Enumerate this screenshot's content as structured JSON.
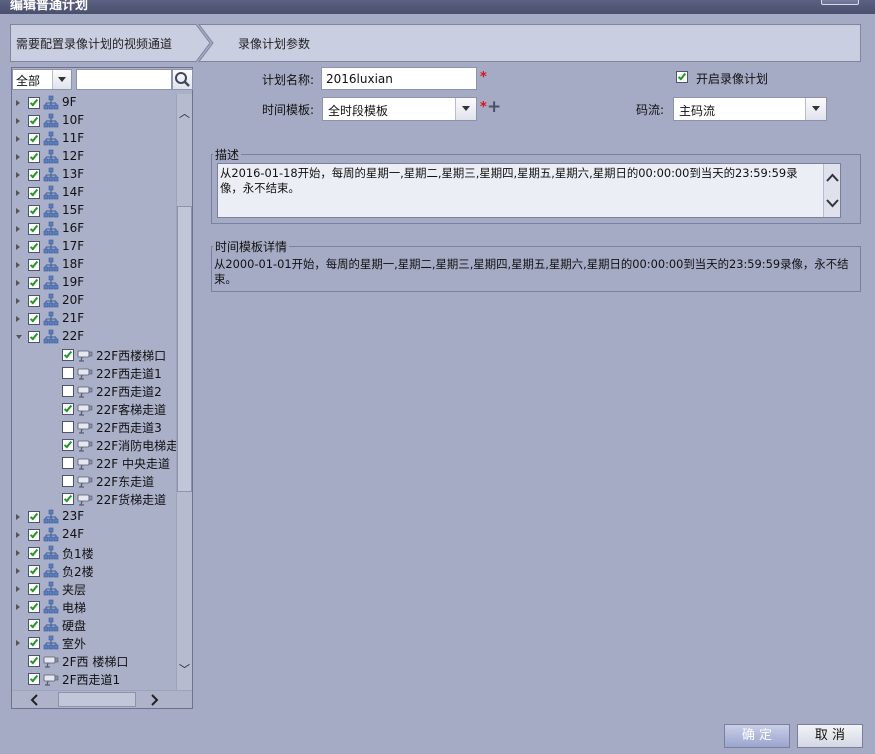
{
  "window": {
    "title": "编辑普通计划"
  },
  "steps": [
    {
      "label": "需要配置录像计划的视频通道"
    },
    {
      "label": "录像计划参数"
    }
  ],
  "filter": {
    "scope_value": "全部",
    "search_value": ""
  },
  "tree": [
    {
      "label": "9F",
      "type": "group",
      "level": 0,
      "checked": true,
      "expanded": false
    },
    {
      "label": "10F",
      "type": "group",
      "level": 0,
      "checked": true,
      "expanded": false
    },
    {
      "label": "11F",
      "type": "group",
      "level": 0,
      "checked": true,
      "expanded": false
    },
    {
      "label": "12F",
      "type": "group",
      "level": 0,
      "checked": true,
      "expanded": false
    },
    {
      "label": "13F",
      "type": "group",
      "level": 0,
      "checked": true,
      "expanded": false
    },
    {
      "label": "14F",
      "type": "group",
      "level": 0,
      "checked": true,
      "expanded": false
    },
    {
      "label": "15F",
      "type": "group",
      "level": 0,
      "checked": true,
      "expanded": false
    },
    {
      "label": "16F",
      "type": "group",
      "level": 0,
      "checked": true,
      "expanded": false
    },
    {
      "label": "17F",
      "type": "group",
      "level": 0,
      "checked": true,
      "expanded": false
    },
    {
      "label": "18F",
      "type": "group",
      "level": 0,
      "checked": true,
      "expanded": false
    },
    {
      "label": "19F",
      "type": "group",
      "level": 0,
      "checked": true,
      "expanded": false
    },
    {
      "label": "20F",
      "type": "group",
      "level": 0,
      "checked": true,
      "expanded": false
    },
    {
      "label": "21F",
      "type": "group",
      "level": 0,
      "checked": true,
      "expanded": false
    },
    {
      "label": "22F",
      "type": "group",
      "level": 0,
      "checked": true,
      "expanded": true
    },
    {
      "label": "22F西楼梯口",
      "type": "camera",
      "level": 1,
      "checked": true
    },
    {
      "label": "22F西走道1",
      "type": "camera",
      "level": 1,
      "checked": false
    },
    {
      "label": "22F西走道2",
      "type": "camera",
      "level": 1,
      "checked": false
    },
    {
      "label": "22F客梯走道",
      "type": "camera",
      "level": 1,
      "checked": true
    },
    {
      "label": "22F西走道3",
      "type": "camera",
      "level": 1,
      "checked": false
    },
    {
      "label": "22F消防电梯走道",
      "type": "camera",
      "level": 1,
      "checked": true
    },
    {
      "label": "22F 中央走道",
      "type": "camera",
      "level": 1,
      "checked": false
    },
    {
      "label": "22F东走道",
      "type": "camera",
      "level": 1,
      "checked": false
    },
    {
      "label": "22F货梯走道",
      "type": "camera",
      "level": 1,
      "checked": true
    },
    {
      "label": "23F",
      "type": "group",
      "level": 0,
      "checked": true,
      "expanded": false
    },
    {
      "label": "24F",
      "type": "group",
      "level": 0,
      "checked": true,
      "expanded": false
    },
    {
      "label": "负1楼",
      "type": "group",
      "level": 0,
      "checked": true,
      "expanded": false
    },
    {
      "label": "负2楼",
      "type": "group",
      "level": 0,
      "checked": true,
      "expanded": false
    },
    {
      "label": "夹层",
      "type": "group",
      "level": 0,
      "checked": true,
      "expanded": false
    },
    {
      "label": "电梯",
      "type": "group",
      "level": 0,
      "checked": true,
      "expanded": false
    },
    {
      "label": "硬盘",
      "type": "group",
      "level": 0,
      "checked": true,
      "expanded": null
    },
    {
      "label": "室外",
      "type": "group",
      "level": 0,
      "checked": true,
      "expanded": false
    },
    {
      "label": "2F西 楼梯口",
      "type": "camera",
      "level": 0,
      "checked": true
    },
    {
      "label": "2F西走道1",
      "type": "camera",
      "level": 0,
      "checked": true
    }
  ],
  "form": {
    "plan_name_label": "计划名称:",
    "plan_name_value": "2016luxian",
    "enable_label": "开启录像计划",
    "enable_checked": true,
    "template_label": "时间模板:",
    "template_value": "全时段模板",
    "stream_label": "码流:",
    "stream_value": "主码流",
    "required_mark": "*",
    "add_symbol": "+"
  },
  "description": {
    "legend": "描述",
    "text": "从2016-01-18开始，每周的星期一,星期二,星期三,星期四,星期五,星期六,星期日的00:00:00到当天的23:59:59录像，永不结束。"
  },
  "template_detail": {
    "legend": "时间模板详情",
    "text": "从2000-01-01开始，每周的星期一,星期二,星期三,星期四,星期五,星期六,星期日的00:00:00到当天的23:59:59录像，永不结束。"
  },
  "buttons": {
    "ok": "确 定",
    "cancel": "取 消"
  },
  "colors": {
    "check": "#1c9a1c",
    "required": "#dd1111",
    "background": "#a5abc4"
  },
  "icons": {
    "group": "org-tree-icon",
    "camera": "camera-icon",
    "search": "search-icon"
  }
}
